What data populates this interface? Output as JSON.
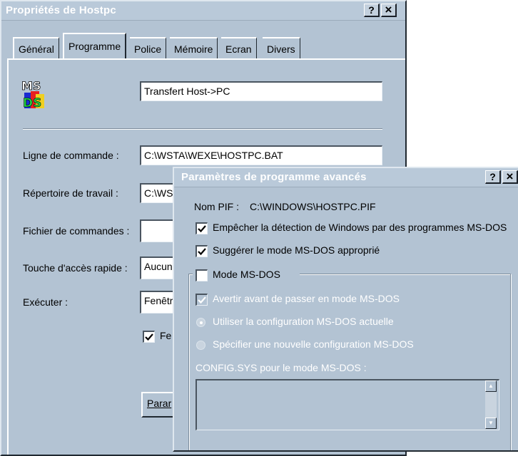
{
  "main_window": {
    "title": "Propriétés de Hostpc",
    "help_button": "?",
    "close_button": "×",
    "tabs": [
      {
        "label": "Général"
      },
      {
        "label": "Programme"
      },
      {
        "label": "Police"
      },
      {
        "label": "Mémoire"
      },
      {
        "label": "Ecran"
      },
      {
        "label": "Divers"
      }
    ],
    "active_tab": "Programme",
    "program_title_value": "Transfert Host->PC",
    "icon": "ms-dos-logo-icon",
    "fields": {
      "command_line": {
        "label": "Ligne de commande :",
        "value": "C:\\WSTA\\WEXE\\HOSTPC.BAT"
      },
      "working_dir": {
        "label": "Répertoire de travail :",
        "value": "C:\\WS"
      },
      "batch_file": {
        "label": "Fichier de commandes :",
        "value": ""
      },
      "shortcut_key": {
        "label": "Touche d'accès rapide :",
        "value": "Aucun"
      },
      "run": {
        "label": "Exécuter :",
        "value": "Fenêtr"
      }
    },
    "close_on_exit_label": "Fe",
    "close_on_exit_checked": true,
    "advanced_button_label": "Parar"
  },
  "advanced_dialog": {
    "title": "Paramètres de programme avancés",
    "help_button": "?",
    "close_button": "×",
    "pif_name_label": "Nom PIF :",
    "pif_name_value": "C:\\WINDOWS\\HOSTPC.PIF",
    "prevent_detection": {
      "label": "Empêcher la détection de Windows par des programmes MS-DOS",
      "checked": true
    },
    "suggest_mode": {
      "label": "Suggérer le mode MS-DOS approprié",
      "checked": true
    },
    "msdos_mode": {
      "label": "Mode MS-DOS",
      "checked": false
    },
    "warn_before": {
      "label": "Avertir avant de passer en mode MS-DOS",
      "checked": true
    },
    "use_current_config": {
      "label": "Utiliser la configuration MS-DOS actuelle",
      "selected": true
    },
    "specify_new_config": {
      "label": "Spécifier une nouvelle configuration MS-DOS",
      "selected": false
    },
    "config_sys_label": "CONFIG.SYS pour le mode MS-DOS :"
  },
  "colors": {
    "window_face": "#b3c3d3",
    "title_text": "#ffffff"
  }
}
